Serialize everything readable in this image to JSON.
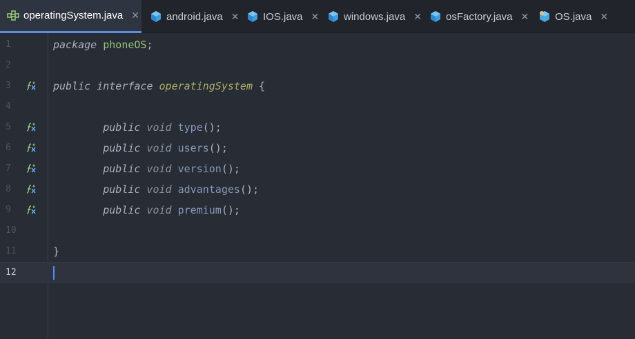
{
  "tabs": [
    {
      "label": "operatingSystem.java",
      "icon": "interface-icon",
      "active": true,
      "close": "✕"
    },
    {
      "label": "android.java",
      "icon": "java-class-icon",
      "active": false,
      "close": "✕"
    },
    {
      "label": "IOS.java",
      "icon": "java-class-icon",
      "active": false,
      "close": "✕"
    },
    {
      "label": "windows.java",
      "icon": "java-class-icon",
      "active": false,
      "close": "✕"
    },
    {
      "label": "osFactory.java",
      "icon": "java-class-icon",
      "active": false,
      "close": "✕"
    },
    {
      "label": "OS.java",
      "icon": "abstract-class-icon",
      "active": false,
      "close": "✕"
    }
  ],
  "lines": [
    {
      "num": "1",
      "gutter": false,
      "parts": [
        [
          "kw",
          "package"
        ],
        [
          "punc",
          " "
        ],
        [
          "pkg",
          "phoneOS"
        ],
        [
          "punc",
          ";"
        ]
      ]
    },
    {
      "num": "2",
      "gutter": false,
      "parts": []
    },
    {
      "num": "3",
      "gutter": true,
      "parts": [
        [
          "kw",
          "public"
        ],
        [
          "punc",
          " "
        ],
        [
          "kw",
          "interface"
        ],
        [
          "punc",
          " "
        ],
        [
          "iname",
          "operatingSystem"
        ],
        [
          "punc",
          " {"
        ]
      ]
    },
    {
      "num": "4",
      "gutter": false,
      "parts": []
    },
    {
      "num": "5",
      "gutter": true,
      "parts": [
        [
          "punc",
          "        "
        ],
        [
          "kw",
          "public"
        ],
        [
          "punc",
          " "
        ],
        [
          "kw2",
          "void"
        ],
        [
          "punc",
          " "
        ],
        [
          "mname",
          "type"
        ],
        [
          "punc",
          "();"
        ]
      ]
    },
    {
      "num": "6",
      "gutter": true,
      "parts": [
        [
          "punc",
          "        "
        ],
        [
          "kw",
          "public"
        ],
        [
          "punc",
          " "
        ],
        [
          "kw2",
          "void"
        ],
        [
          "punc",
          " "
        ],
        [
          "mname",
          "users"
        ],
        [
          "punc",
          "();"
        ]
      ]
    },
    {
      "num": "7",
      "gutter": true,
      "parts": [
        [
          "punc",
          "        "
        ],
        [
          "kw",
          "public"
        ],
        [
          "punc",
          " "
        ],
        [
          "kw2",
          "void"
        ],
        [
          "punc",
          " "
        ],
        [
          "mname",
          "version"
        ],
        [
          "punc",
          "();"
        ]
      ]
    },
    {
      "num": "8",
      "gutter": true,
      "parts": [
        [
          "punc",
          "        "
        ],
        [
          "kw",
          "public"
        ],
        [
          "punc",
          " "
        ],
        [
          "kw2",
          "void"
        ],
        [
          "punc",
          " "
        ],
        [
          "mname",
          "advantages"
        ],
        [
          "punc",
          "();"
        ]
      ]
    },
    {
      "num": "9",
      "gutter": true,
      "parts": [
        [
          "punc",
          "        "
        ],
        [
          "kw",
          "public"
        ],
        [
          "punc",
          " "
        ],
        [
          "kw2",
          "void"
        ],
        [
          "punc",
          " "
        ],
        [
          "mname",
          "premium"
        ],
        [
          "punc",
          "();"
        ]
      ]
    },
    {
      "num": "10",
      "gutter": false,
      "parts": []
    },
    {
      "num": "11",
      "gutter": false,
      "parts": [
        [
          "punc",
          "}"
        ]
      ]
    },
    {
      "num": "12",
      "gutter": false,
      "current": true,
      "parts": []
    }
  ],
  "colors": {
    "accent": "#5c8edb",
    "background": "#282c34",
    "tabbar": "#21252b"
  }
}
